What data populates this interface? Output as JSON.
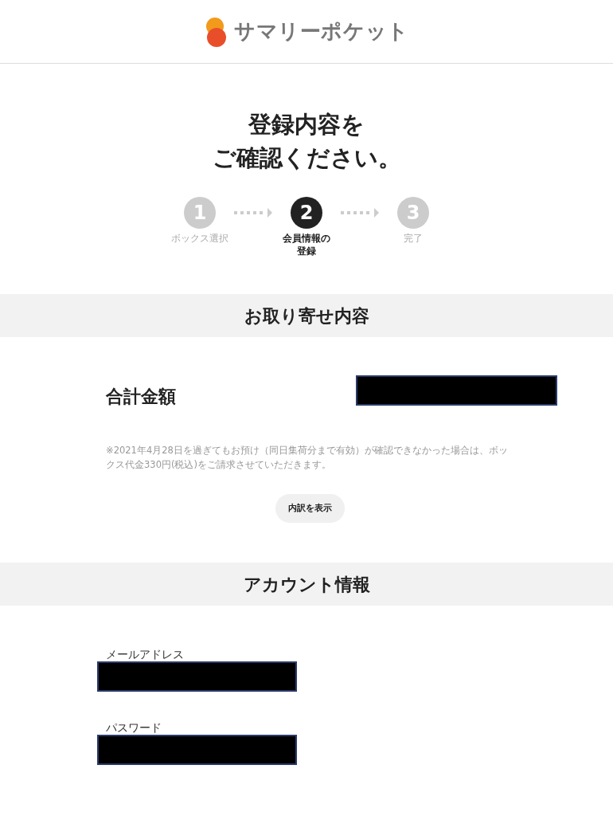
{
  "header": {
    "logo_text": "サマリーポケット"
  },
  "title": [
    "登録内容を",
    "ご確認ください。"
  ],
  "steps": [
    {
      "number": "1",
      "label": "ボックス選択",
      "selected": false
    },
    {
      "number": "2",
      "label": "会員情報の登録",
      "selected": true
    },
    {
      "number": "3",
      "label": "完了",
      "selected": false
    }
  ],
  "order_section": {
    "heading": "お取り寄せ内容",
    "total_label": "合計金額",
    "note": "※2021年4月28日を過ぎてもお預け（同日集荷分まで有効）が確認できなかった場合は、ボックス代金330円(税込)をご請求させていただきます。",
    "button": "内訳を表示"
  },
  "account_section": {
    "heading": "アカウント情報",
    "fields": [
      {
        "label": "メールアドレス"
      },
      {
        "label": "パスワード"
      }
    ]
  }
}
